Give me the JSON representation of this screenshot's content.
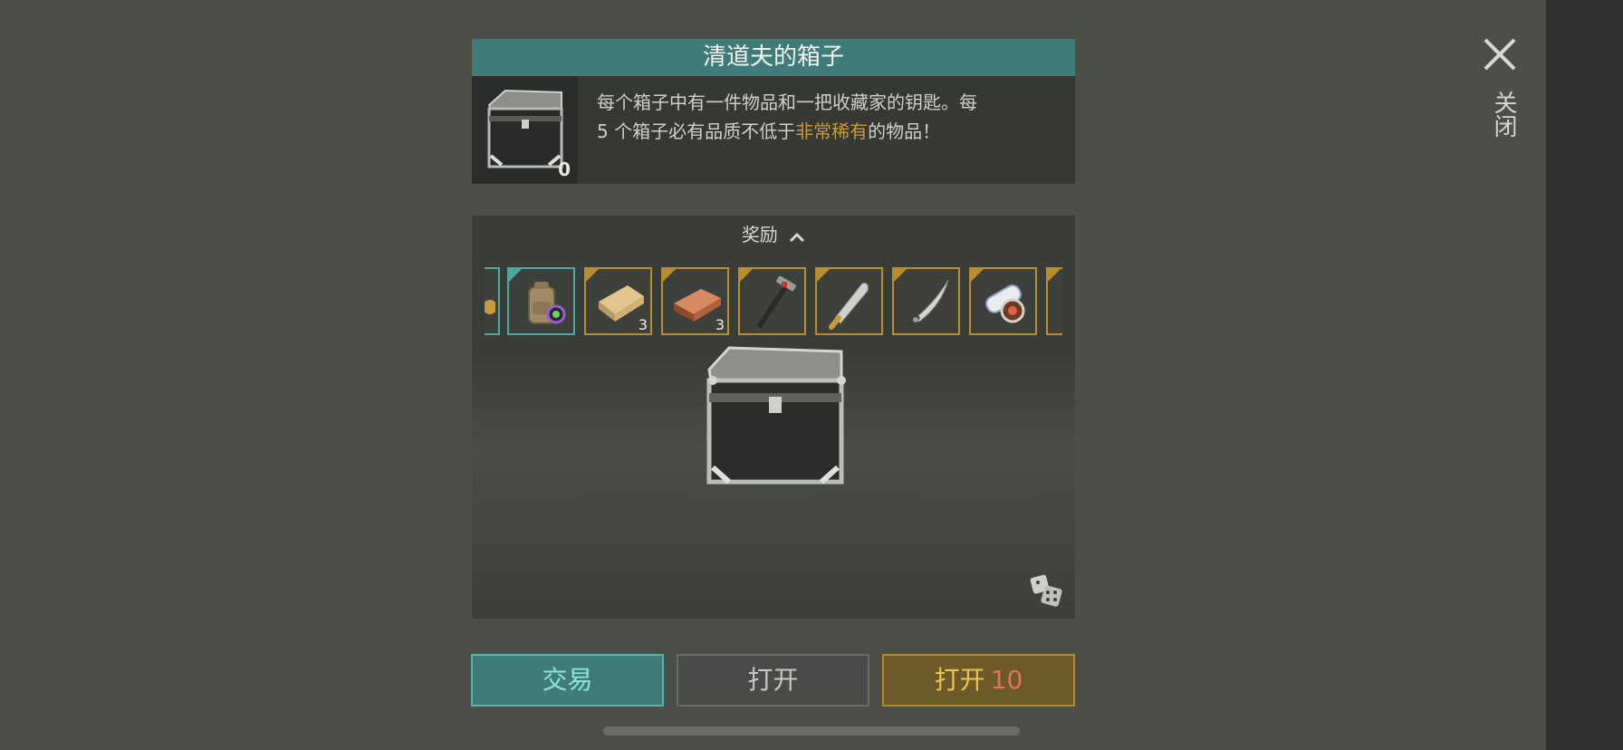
{
  "header": {
    "title": "清道夫的箱子",
    "chest_count": "0",
    "description_part1": "每个箱子中有一件物品和一把收藏家的钥匙。每 5 个箱子必有品质不低于",
    "description_highlight": "非常稀有",
    "description_part2": "的物品！",
    "highlight_color": "#c99a3c"
  },
  "close": {
    "label": "关闭",
    "icon": "close-icon"
  },
  "rewards": {
    "toggle_label": "奖励",
    "items": [
      {
        "name": "partial-item",
        "qty": "",
        "rarity": "teal"
      },
      {
        "name": "backpack",
        "qty": "",
        "rarity": "teal"
      },
      {
        "name": "wood-plank",
        "qty": "3",
        "rarity": "gold"
      },
      {
        "name": "copper-ingot",
        "qty": "3",
        "rarity": "gold"
      },
      {
        "name": "hammer",
        "qty": "",
        "rarity": "gold"
      },
      {
        "name": "machete",
        "qty": "",
        "rarity": "gold"
      },
      {
        "name": "sword",
        "qty": "",
        "rarity": "gold"
      },
      {
        "name": "blueprint-scroll",
        "qty": "",
        "rarity": "gold"
      },
      {
        "name": "partial-item",
        "qty": "",
        "rarity": "gold"
      }
    ]
  },
  "buttons": {
    "trade": "交易",
    "open": "打开",
    "open10_label": "打开",
    "open10_count": "10"
  },
  "colors": {
    "teal": "#3f7b79",
    "gold": "#b98c2e",
    "background": "#4c4f47"
  }
}
